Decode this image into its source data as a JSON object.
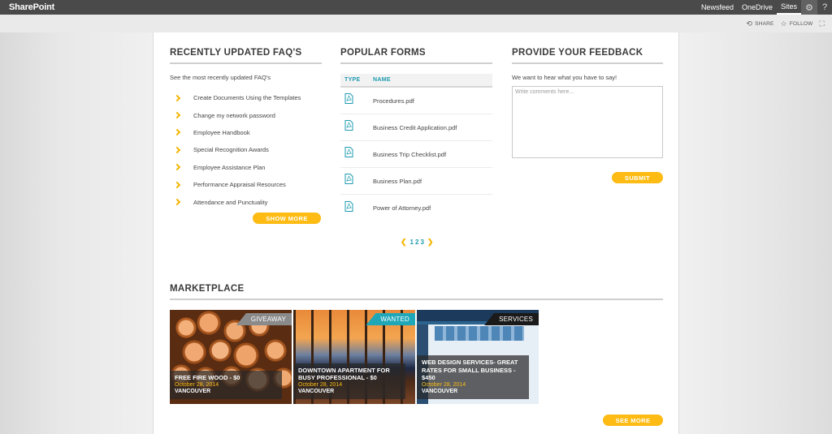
{
  "suite": {
    "brand": "SharePoint",
    "links": [
      "Newsfeed",
      "OneDrive",
      "Sites"
    ],
    "help": "?"
  },
  "cmdbar": {
    "share": "SHARE",
    "follow": "FOLLOW"
  },
  "faq": {
    "heading": "RECENTLY UPDATED FAQ'S",
    "intro": "See the most recently updated FAQ's",
    "items": [
      "Create Documents Using the Templates",
      "Change my network password",
      "Employee Handbook",
      "Special Recognition Awards",
      "Employee Assistance Plan",
      "Performance Appraisal Resources",
      "Attendance and Punctuality"
    ],
    "show_more": "SHOW MORE"
  },
  "forms": {
    "heading": "POPULAR FORMS",
    "col_type": "TYPE",
    "col_name": "NAME",
    "rows": [
      "Procedures.pdf",
      "Business Credit Application.pdf",
      "Business Trip Checklist.pdf",
      "Business Plan.pdf",
      "Power of Attorney.pdf"
    ],
    "pages": [
      "1",
      "2",
      "3"
    ]
  },
  "feedback": {
    "heading": "PROVIDE YOUR FEEDBACK",
    "intro": "We want to hear what you have to say!",
    "placeholder": "Write comments here...",
    "submit": "SUBMIT"
  },
  "market": {
    "heading": "MARKETPLACE",
    "cards": [
      {
        "tag": "GIVEAWAY",
        "tag_color": "#8a8a8a",
        "title": "FREE FIRE WOOD - $0",
        "date": "October 28, 2014",
        "location": "VANCOUVER"
      },
      {
        "tag": "WANTED",
        "tag_color": "#1fa7b8",
        "title": "DOWNTOWN APARTMENT FOR BUSY PROFESSIONAL - $0",
        "date": "October 28, 2014",
        "location": "VANCOUVER"
      },
      {
        "tag": "SERVICES",
        "tag_color": "#1a1a1a",
        "title": "WEB DESIGN SERVICES- GREAT RATES FOR SMALL BUSINESS - $450",
        "date": "October 28, 2014",
        "location": "VANCOUVER"
      }
    ],
    "see_more": "SEE MORE"
  },
  "colors": {
    "accent": "#fdbb13",
    "teal": "#1f9bb0"
  }
}
